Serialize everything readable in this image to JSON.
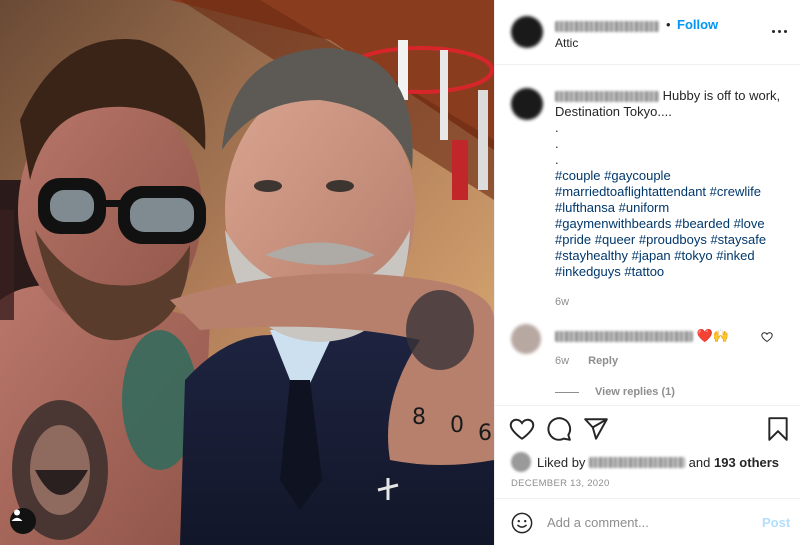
{
  "post": {
    "username": "blurred-username",
    "separator": "•",
    "follow_label": "Follow",
    "location": "Attic",
    "more_icon": "more-horizontal-icon"
  },
  "caption": {
    "text": "Hubby is off to work, Destination Tokyo....",
    "dots": [
      ".",
      ".",
      "."
    ],
    "hashtags": [
      [
        "#couple",
        "#gaycouple"
      ],
      [
        "#marriedtoaflightattendant",
        "#crewlife"
      ],
      [
        "#lufthansa",
        "#uniform"
      ],
      [
        "#gaymenwithbeards",
        "#bearded",
        "#love"
      ],
      [
        "#pride",
        "#queer",
        "#proudboys",
        "#staysafe"
      ],
      [
        "#stayhealthy",
        "#japan",
        "#tokyo",
        "#inked"
      ],
      [
        "#inkedguys",
        "#tattoo"
      ]
    ],
    "time": "6w"
  },
  "comment": {
    "emojis": "❤️🙌",
    "time": "6w",
    "reply_label": "Reply",
    "view_replies": "View replies (1)"
  },
  "actions": {
    "liked_prefix": "Liked by",
    "liked_and": "and",
    "liked_count": "193 others",
    "date": "DECEMBER 13, 2020"
  },
  "composer": {
    "placeholder": "Add a comment...",
    "post_label": "Post"
  },
  "colors": {
    "link": "#0095f6",
    "hashtag": "#00376b",
    "muted": "#8e8e8e",
    "post_disabled": "#b2dffc"
  }
}
